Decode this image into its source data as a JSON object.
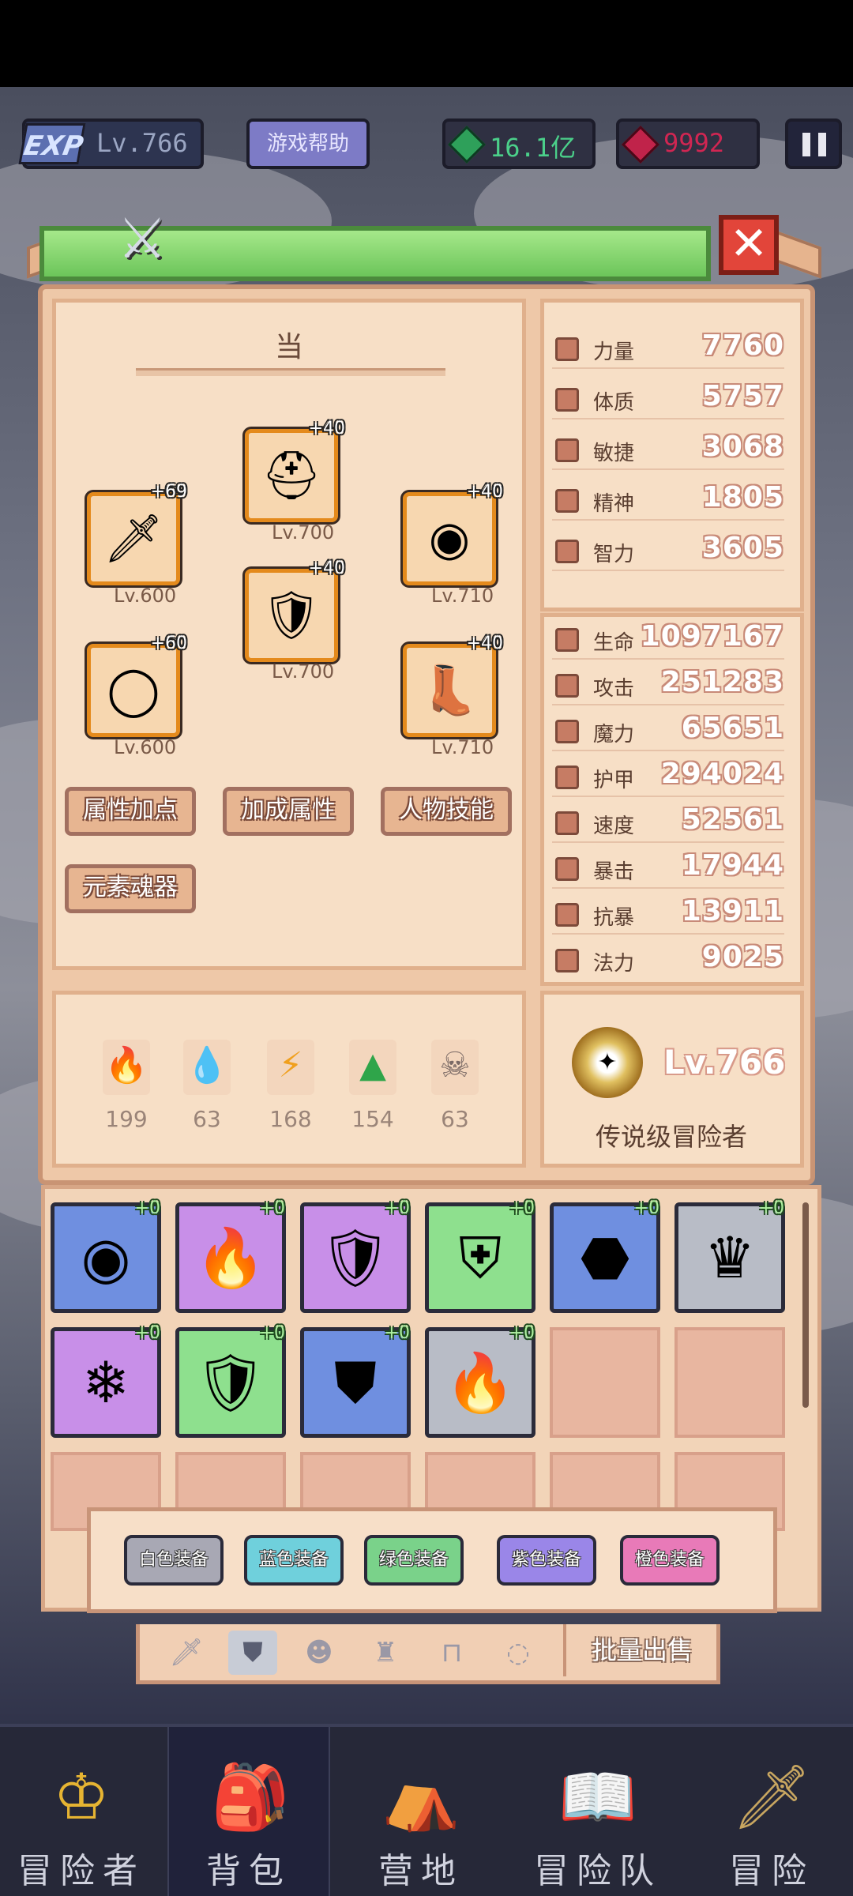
{
  "hud": {
    "exp_tag": "EXP",
    "level": "Lv.766",
    "help_button": "游戏帮助",
    "gems": "16.1亿",
    "rubies": "9992"
  },
  "character": {
    "name": "当",
    "slots": [
      {
        "plus": "+40",
        "level": "Lv.700",
        "icon": "helmet-icon"
      },
      {
        "plus": "+69",
        "level": "Lv.600",
        "icon": "sword-icon"
      },
      {
        "plus": "+40",
        "level": "Lv.710",
        "icon": "shield-icon"
      },
      {
        "plus": "+40",
        "level": "Lv.700",
        "icon": "armor-icon"
      },
      {
        "plus": "+60",
        "level": "Lv.600",
        "icon": "ring-icon"
      },
      {
        "plus": "+40",
        "level": "Lv.710",
        "icon": "boots-icon"
      }
    ],
    "buttons": [
      "属性加点",
      "加成属性",
      "人物技能",
      "元素魂器"
    ]
  },
  "base_stats": [
    {
      "label": "力量",
      "value": "7760"
    },
    {
      "label": "体质",
      "value": "5757"
    },
    {
      "label": "敏捷",
      "value": "3068"
    },
    {
      "label": "精神",
      "value": "1805"
    },
    {
      "label": "智力",
      "value": "3605"
    }
  ],
  "combat_stats": [
    {
      "label": "生命",
      "value": "1097167"
    },
    {
      "label": "攻击",
      "value": "251283"
    },
    {
      "label": "魔力",
      "value": "65651"
    },
    {
      "label": "护甲",
      "value": "294024"
    },
    {
      "label": "速度",
      "value": "52561"
    },
    {
      "label": "暴击",
      "value": "17944"
    },
    {
      "label": "抗暴",
      "value": "13911"
    },
    {
      "label": "法力",
      "value": "9025"
    }
  ],
  "elements": [
    {
      "icon": "fire-element-icon",
      "value": "199",
      "color": "#f05a2a"
    },
    {
      "icon": "water-element-icon",
      "value": "63",
      "color": "#3a8ee8"
    },
    {
      "icon": "lightning-element-icon",
      "value": "168",
      "color": "#f0a01e"
    },
    {
      "icon": "earth-element-icon",
      "value": "154",
      "color": "#2fa54a"
    },
    {
      "icon": "skull-element-icon",
      "value": "63",
      "color": "#7a6a66"
    }
  ],
  "rank": {
    "level": "Lv.766",
    "title": "传说级冒险者"
  },
  "inventory": {
    "items": [
      {
        "plus": "+0",
        "bg": "#6f8fe0",
        "icon": "round-shield-icon"
      },
      {
        "plus": "+0",
        "bg": "#c88fe8",
        "icon": "flame-crest-icon"
      },
      {
        "plus": "+0",
        "bg": "#c88fe8",
        "icon": "gold-shield-icon"
      },
      {
        "plus": "+0",
        "bg": "#8ee08e",
        "icon": "ornate-shield-icon"
      },
      {
        "plus": "+0",
        "bg": "#6f8fe0",
        "icon": "dark-shield-icon"
      },
      {
        "plus": "+0",
        "bg": "#b8bcc6",
        "icon": "armor-crest-icon"
      },
      {
        "plus": "+0",
        "bg": "#c88fe8",
        "icon": "ice-shield-icon"
      },
      {
        "plus": "+0",
        "bg": "#8ee08e",
        "icon": "steel-shield-icon"
      },
      {
        "plus": "+0",
        "bg": "#6f8fe0",
        "icon": "winged-shield-icon"
      },
      {
        "plus": "+0",
        "bg": "#b8bcc6",
        "icon": "flame-crest-icon"
      }
    ],
    "filters": [
      {
        "label": "白色装备",
        "color": "#a8a8b4"
      },
      {
        "label": "蓝色装备",
        "color": "#6fd0dc"
      },
      {
        "label": "绿色装备",
        "color": "#7ad28a"
      },
      {
        "label": "紫色装备",
        "color": "#9a86e8"
      },
      {
        "label": "橙色装备",
        "color": "#e87ab8"
      }
    ],
    "bulk_sell": "批量出售"
  },
  "nav": [
    {
      "label": "冒险者",
      "icon": "helmet-nav-icon"
    },
    {
      "label": "背包",
      "icon": "backpack-nav-icon"
    },
    {
      "label": "营地",
      "icon": "camp-nav-icon"
    },
    {
      "label": "冒险队",
      "icon": "book-nav-icon"
    },
    {
      "label": "冒险",
      "icon": "sword-nav-icon"
    }
  ]
}
